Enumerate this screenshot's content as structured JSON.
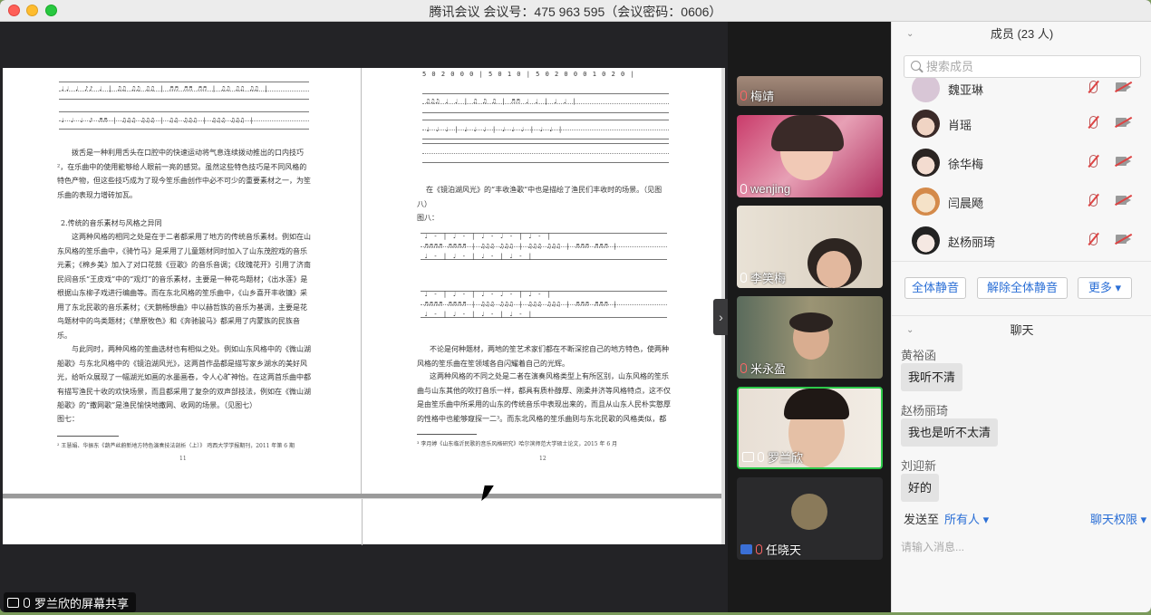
{
  "window": {
    "title": "腾讯会议 会议号：475 963 595（会议密码：0606）"
  },
  "share": {
    "label": "罗兰欣的屏幕共享",
    "document": {
      "left_page": {
        "paragraph1": "拨舌是一种利用舌头在口腔中的快速运动将气息连续拨动推出的口内技巧²，在乐曲中的使用能够给人眼前一亮的感觉。虽然这些特色技巧是不同风格的特色产物，但这些技巧成为了现今笙乐曲创作中必不可少的重要素材之一，为笙乐曲的表现力增砖加瓦。",
        "heading": "2.传统的音乐素材与风格之异同",
        "paragraph2": "这两种风格的相同之处是在于二者都采用了地方的传统音乐素材。例如在山东风格的笙乐曲中，《骑竹马》是采用了儿童题材同时加入了山东茂腔戏的音乐元素；《棉乡美》加入了对口花鼓《豆歌》的音乐音调；《玫瑰花开》引用了济南民间音乐“王皮戏”中的“观灯”的音乐素材，主要是一种花鸟题材；《出水莲》是根据山东柳子戏进行编曲等。而在东北风格的笙乐曲中，《山乡喜开丰收镰》采用了东北民歌的音乐素材；《天鹅畅想曲》中以赫哲族的音乐为基调，主要是花鸟题材中的鸟类题材；《草原牧色》和《奔驰骏马》都采用了内蒙族的民族音乐。",
        "paragraph3": "与此同时，两种风格的笙曲选材也有相似之处。例如山东风格中的《微山湖船歌》与东北风格中的《镜泊湖风光》，这两首作品都是描写家乡湖水的美好风光，给听众展现了一幅湖光如画的水墨画卷，令人心旷神怡。在这两首乐曲中都有描写渔民十收的欢快场景，而且都采用了复杂的双声部技法，例如在《微山湖船歌》的“撒网歌”是渔民愉快地撒网、收网的场景。（见图七）",
        "figure_label": "图七：",
        "footnote": "² 王慧娟、华振东《葫芦丝蔚新地方特色演奏技法剖析（上）》 鸡西大学学报期刊，2011 年第 6 期",
        "page_number": "11",
        "score_top_row1": "♩♩ ♩ ♪♪ ♩ | ♫♫ ♫♫ ♫♫ | ♬♬ ♬♬ ♬♬ | ♫♫ ♫♫ ♫♫ |",
        "score_top_row2": "♩ ♩ ♩ ♪ ♬♬ | ♫♫♫ ♫♫♫ | ♫♫ ♫♫♫ | ♫♫♫ ♫♫♫ |"
      },
      "right_page": {
        "score_row1": "5 0 2 0 0 0 | 5 0 1 0 | 5 0 2 0 0 0 1 0 2 0 |",
        "score_row2": "♫♫♫ ♩ ♩ | ♫ ♫ ♫ | ♬♬ ♩ ♩ | ♩ ♩ |",
        "score_row3": "♩ ♩ ♩ | ♩ ♩ ♩ | ♩ ♩ ♩ | ♩ ♩ |",
        "paragraph1": "在《镜泊湖风光》的“丰收渔歌”中也是描绘了渔民们丰收时的场景。（见图八）",
        "figure_label": "图八：",
        "score_fig8_a1": "♩ - | ♩ - | ♩ - ♩ - | ♩ - |",
        "score_fig8_a2": "♬♬♬♬ ♬♬♬♬ | ♫♫♫ ♫♫♫ | ♫♫♫ ♫♫♫ | ♬♬♬ ♬♬♬ |",
        "score_fig8_a3": "♩ - | ♩ - | ♩ - | ♩ - |",
        "score_fig8_b1": "♩ - | ♩ - | ♩ - ♩ - | ♩ - |",
        "score_fig8_b2": "♬♬♬♬ ♬♬♬♬ | ♫♫♫ ♫♫♫ | ♫♫♫ ♫♫♫ | ♬♬♬ ♬♬♬ |",
        "score_fig8_b3": "♩ - | ♩ - | ♩ - | ♩ - |",
        "paragraph2": "不论是何种题材，两地的笙艺术家们都在不断深挖自己的地方特色，使两种风格的笙乐曲在笙领域各自闪耀着自己的光辉。",
        "paragraph3": "这两种风格的不同之处是二者在演奏风格类型上有所区别，山东风格的笙乐曲与山东其他的吹打音乐一样，都具有质朴醇厚、刚柔并济等风格特点，这不仅是由笙乐曲中所采用的山东的传统音乐中表现出来的，而且从山东人民朴实憨厚的性格中也能够窥探一二³。而东北风格的笙乐曲则与东北民歌的风格类似，都",
        "footnote": "³ 李月婷《山东临沂民歌的音乐风格研究》哈尔滨师范大学硕士论文，2015 年 6 月",
        "page_number": "12"
      }
    }
  },
  "gallery": [
    {
      "name": "梅靖",
      "mic": "muted"
    },
    {
      "name": "wenjing",
      "mic": "on"
    },
    {
      "name": "李笑梅",
      "mic": "on"
    },
    {
      "name": "米永盈",
      "mic": "muted"
    },
    {
      "name": "罗兰欣",
      "mic": "on",
      "sharing": true
    },
    {
      "name": "任晓天",
      "mic": "muted"
    }
  ],
  "sidebar": {
    "members_title": "成员 (23 人)",
    "search_placeholder": "搜索成员",
    "members": [
      {
        "name": "魏亚琳"
      },
      {
        "name": "肖瑶"
      },
      {
        "name": "徐华梅"
      },
      {
        "name": "闫晨飏"
      },
      {
        "name": "赵杨丽琦"
      }
    ],
    "buttons": {
      "mute_all": "全体静音",
      "unmute_all": "解除全体静音",
      "more": "更多 ▾"
    },
    "chat_title": "聊天",
    "messages": [
      {
        "sender": "黄裕函",
        "text": "我听不清"
      },
      {
        "sender": "赵杨丽琦",
        "text": "我也是听不太清"
      },
      {
        "sender": "刘迎新",
        "text": "好的"
      }
    ],
    "send_to_label": "发送至",
    "send_to_value": "所有人",
    "chat_permission": "聊天权限",
    "input_placeholder": "请输入消息..."
  },
  "colors": {
    "accent": "#2b6fd6",
    "active_speaker": "#2dc94a",
    "muted": "#d44444"
  }
}
